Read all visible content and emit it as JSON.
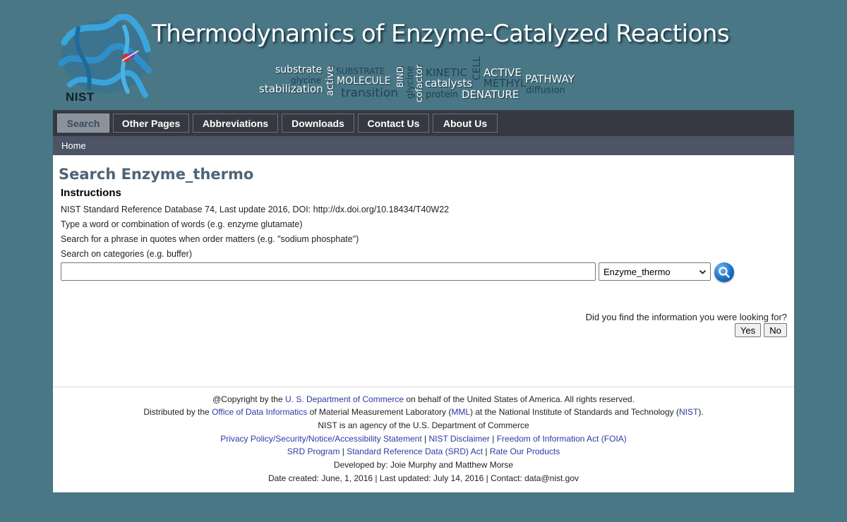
{
  "banner": {
    "title": "Thermodynamics of Enzyme-Catalyzed Reactions",
    "logo": "NIST",
    "word_cloud": [
      "substrate",
      "glycine",
      "stabilization",
      "active",
      "SUBSTRATE",
      "MOLECULE",
      "transition",
      "BIND",
      "glycine",
      "cofactor",
      "KINETIC",
      "catalysts",
      "protein",
      "CELL",
      "ACTIVE",
      "METHYL",
      "DENATURE",
      "PATHWAY",
      "diffusion"
    ]
  },
  "nav": {
    "items": [
      "Search",
      "Other Pages",
      "Abbreviations",
      "Downloads",
      "Contact Us",
      "About Us"
    ],
    "active": "Search"
  },
  "breadcrumb": {
    "home": "Home"
  },
  "main": {
    "title": "Search Enzyme_thermo",
    "instructions_heading": "Instructions",
    "lines": [
      "NIST Standard Reference Database 74, Last update 2016, DOI: http://dx.doi.org/10.18434/T40W22",
      "Type a word or combination of words (e.g. enzyme glutamate)",
      "Search for a phrase in quotes when order matters (e.g. \"sodium phosphate\")",
      "Search on categories (e.g. buffer)"
    ],
    "search_value": "",
    "category_selected": "Enzyme_thermo"
  },
  "feedback": {
    "question": "Did you find the information you were looking for?",
    "yes": "Yes",
    "no": "No"
  },
  "footer": {
    "copyright_pre": "@Copyright by the ",
    "copyright_link": "U. S. Department of Commerce",
    "copyright_post": " on behalf of the United States of America. All rights reserved.",
    "distributed_pre": "Distributed by the ",
    "odi_link": "Office of Data Informatics",
    "distributed_mid": " of Material Measurement Laboratory (",
    "mml_link": "MML",
    "distributed_mid2": ") at the National Institute of Standards and Technology (",
    "nist_link": "NIST",
    "distributed_post": ").",
    "agency": "NIST is an agency of the U.S. Department of Commerce",
    "privacy_link": "Privacy Policy/Security/Notice/Accessibility Statement",
    "disclaimer_link": "NIST Disclaimer",
    "foia_link": "Freedom of Information Act (FOIA)",
    "srd_program_link": "SRD Program",
    "srd_act_link": "Standard Reference Data (SRD) Act",
    "rate_link": "Rate Our Products",
    "sep": " | ",
    "developed": "Developed by: Joie Murphy and Matthew Morse",
    "dates": "Date created: June, 1, 2016 | Last updated: July 14, 2016 | Contact: data@nist.gov"
  },
  "colors": {
    "background": "#497786",
    "nav_bar": "#373942",
    "subnav_bar": "#4c5466",
    "title": "#4e6477",
    "link": "#2d3aa6",
    "search_button": "#1a6fc2"
  },
  "icons": {
    "search_button": "magnifier-icon",
    "select": "chevron-down-icon",
    "banner_art": "protein-structure-icon"
  }
}
